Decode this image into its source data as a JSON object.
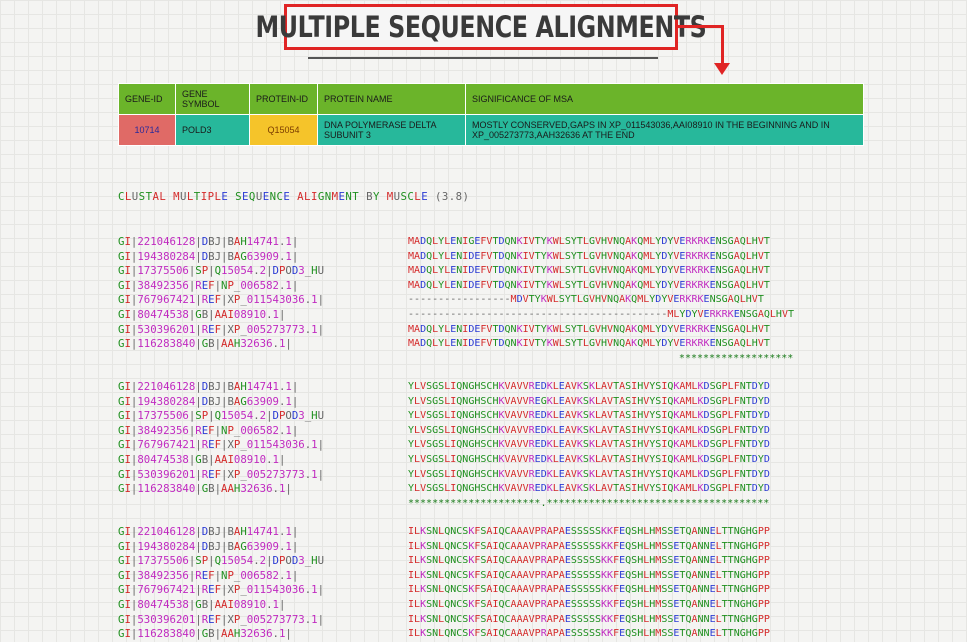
{
  "banner": {
    "title": "MULTIPLE SEQUENCE ALIGNMENTS"
  },
  "info_table": {
    "headers": [
      "GENE-ID",
      "GENE SYMBOL",
      "PROTEIN-ID",
      "PROTEIN NAME",
      "SIGNIFICANCE OF MSA"
    ],
    "row": {
      "gene_id": "10714",
      "gene_symbol": "POLD3",
      "protein_id": "Q15054",
      "protein_name": "DNA POLYMERASE DELTA SUBUNIT 3",
      "significance": "MOSTLY CONSERVED,GAPS IN XP_011543036,AAI08910 IN THE BEGINNING AND IN XP_005273773,AAH32636 AT THE END"
    }
  },
  "alignment": {
    "header": "CLUSTAL MULTIPLE SEQUENCE ALIGNMENT BY MUSCLE (3.8)",
    "blocks": [
      {
        "rows": [
          {
            "id": "GI|221046128|DBJ|BAH14741.1|",
            "seq": "MADQLYLENIGEFVTDQNKIVTYKWLSYTLGVHVNQAKQMLYDYVERKRKENSGAQLHVT"
          },
          {
            "id": "GI|194380284|DBJ|BAG63909.1|",
            "seq": "MADQLYLENIDEFVTDQNKIVTYKWLSYTLGVHVNQAKQMLYDYVERKRKENSGAQLHVT"
          },
          {
            "id": "GI|17375506|SP|Q15054.2|DPOD3_HU",
            "seq": "MADQLYLENIDEFVTDQNKIVTYKWLSYTLGVHVNQAKQMLYDYVERKRKENSGAQLHVT"
          },
          {
            "id": "GI|38492356|REF|NP_006582.1|",
            "seq": "MADQLYLENIDEFVTDQNKIVTYKWLSYTLGVHVNQAKQMLYDYVERKRKENSGAQLHVT"
          },
          {
            "id": "GI|767967421|REF|XP_011543036.1|",
            "seq": "-----------------MDVTYKWLSYTLGVHVNQAKQMLYDYVERKRKENSGAQLHVT"
          },
          {
            "id": "GI|80474538|GB|AAI08910.1|",
            "seq": "-------------------------------------------MLYDYVERKRKENSGAQLHVT"
          },
          {
            "id": "GI|530396201|REF|XP_005273773.1|",
            "seq": "MADQLYLENIDEFVTDQNKIVTYKWLSYTLGVHVNQAKQMLYDYVERKRKENSGAQLHVT"
          },
          {
            "id": "GI|116283840|GB|AAH32636.1|",
            "seq": "MADQLYLENIDEFVTDQNKIVTYKWLSYTLGVHVNQAKQMLYDYVERKRKENSGAQLHVT"
          }
        ],
        "consensus": "                                             *******************"
      },
      {
        "rows": [
          {
            "id": "GI|221046128|DBJ|BAH14741.1|",
            "seq": "YLVSGSLIQNGHSCHKVAVVREDKLEAVKSKLAVTASIHVYSIQKAMLKDSGPLFNTDYD"
          },
          {
            "id": "GI|194380284|DBJ|BAG63909.1|",
            "seq": "YLVSGSLIQNGHSCHKVAVVREGKLEAVKSKLAVTASIHVYSIQKAMLKDSGPLFNTDYD"
          },
          {
            "id": "GI|17375506|SP|Q15054.2|DPOD3_HU",
            "seq": "YLVSGSLIQNGHSCHKVAVVREDKLEAVKSKLAVTASIHVYSIQKAMLKDSGPLFNTDYD"
          },
          {
            "id": "GI|38492356|REF|NP_006582.1|",
            "seq": "YLVSGSLIQNGHSCHKVAVVREDKLEAVKSKLAVTASIHVYSIQKAMLKDSGPLFNTDYD"
          },
          {
            "id": "GI|767967421|REF|XP_011543036.1|",
            "seq": "YLVSGSLIQNGHSCHKVAVVREDKLEAVKSKLAVTASIHVYSIQKAMLKDSGPLFNTDYD"
          },
          {
            "id": "GI|80474538|GB|AAI08910.1|",
            "seq": "YLVSGSLIQNGHSCHKVAVVREDKLEAVKSKLAVTASIHVYSIQKAMLKDSGPLFNTDYD"
          },
          {
            "id": "GI|530396201|REF|XP_005273773.1|",
            "seq": "YLVSGSLIQNGHSCHKVAVVREDKLEAVKSKLAVTASIHVYSIQKAMLKDSGPLFNTDYD"
          },
          {
            "id": "GI|116283840|GB|AAH32636.1|",
            "seq": "YLVSGSLIQNGHSCHKVAVVREDKLEAVKSKLAVTASIHVYSIQKAMLKDSGPLFNTDYD"
          }
        ],
        "consensus": "**********************.*************************************"
      },
      {
        "rows": [
          {
            "id": "GI|221046128|DBJ|BAH14741.1|",
            "seq": "ILKSNLQNCSKFSAIQCAAAVPRAPAESSSSSKKFEQSHLHMSSETQANNELTTNGHGPP"
          },
          {
            "id": "GI|194380284|DBJ|BAG63909.1|",
            "seq": "ILKSNLQNCSKFSAIQCAAAVPRAPAESSSSSKKFEQSHLHMSSETQANNELTTNGHGPP"
          },
          {
            "id": "GI|17375506|SP|Q15054.2|DPOD3_HU",
            "seq": "ILKSNLQNCSKFSAIQCAAAVPRAPAESSSSSKKFEQSHLHMSSETQANNELTTNGHGPP"
          },
          {
            "id": "GI|38492356|REF|NP_006582.1|",
            "seq": "ILKSNLQNCSKFSAIQCAAAVPRAPAESSSSSKKFEQSHLHMSSETQANNELTTNGHGPP"
          },
          {
            "id": "GI|767967421|REF|XP_011543036.1|",
            "seq": "ILKSNLQNCSKFSAIQCAAAVPRAPAESSSSSKKFEQSHLHMSSETQANNELTTNGHGPP"
          },
          {
            "id": "GI|80474538|GB|AAI08910.1|",
            "seq": "ILKSNLQNCSKFSAIQCAAAVPRAPAESSSSSKKFEQSHLHMSSETQANNELTTNGHGPP"
          },
          {
            "id": "GI|530396201|REF|XP_005273773.1|",
            "seq": "ILKSNLQNCSKFSAIQCAAAVPRAPAESSSSSKKFEQSHLHMSSETQANNELTTNGHGPP"
          },
          {
            "id": "GI|116283840|GB|AAH32636.1|",
            "seq": "ILKSNLQNCSKFSAIQCAAAVPRAPAESSSSSKKFEQSHLHMSSETQANNELTTNGHGPP"
          }
        ],
        "consensus": ""
      }
    ]
  },
  "colors": {
    "banner_border": "#e02424",
    "header_green": "#6bb42a",
    "teal": "#27b89b",
    "red_cell": "#e06a66",
    "yellow_cell": "#f5c42a"
  }
}
